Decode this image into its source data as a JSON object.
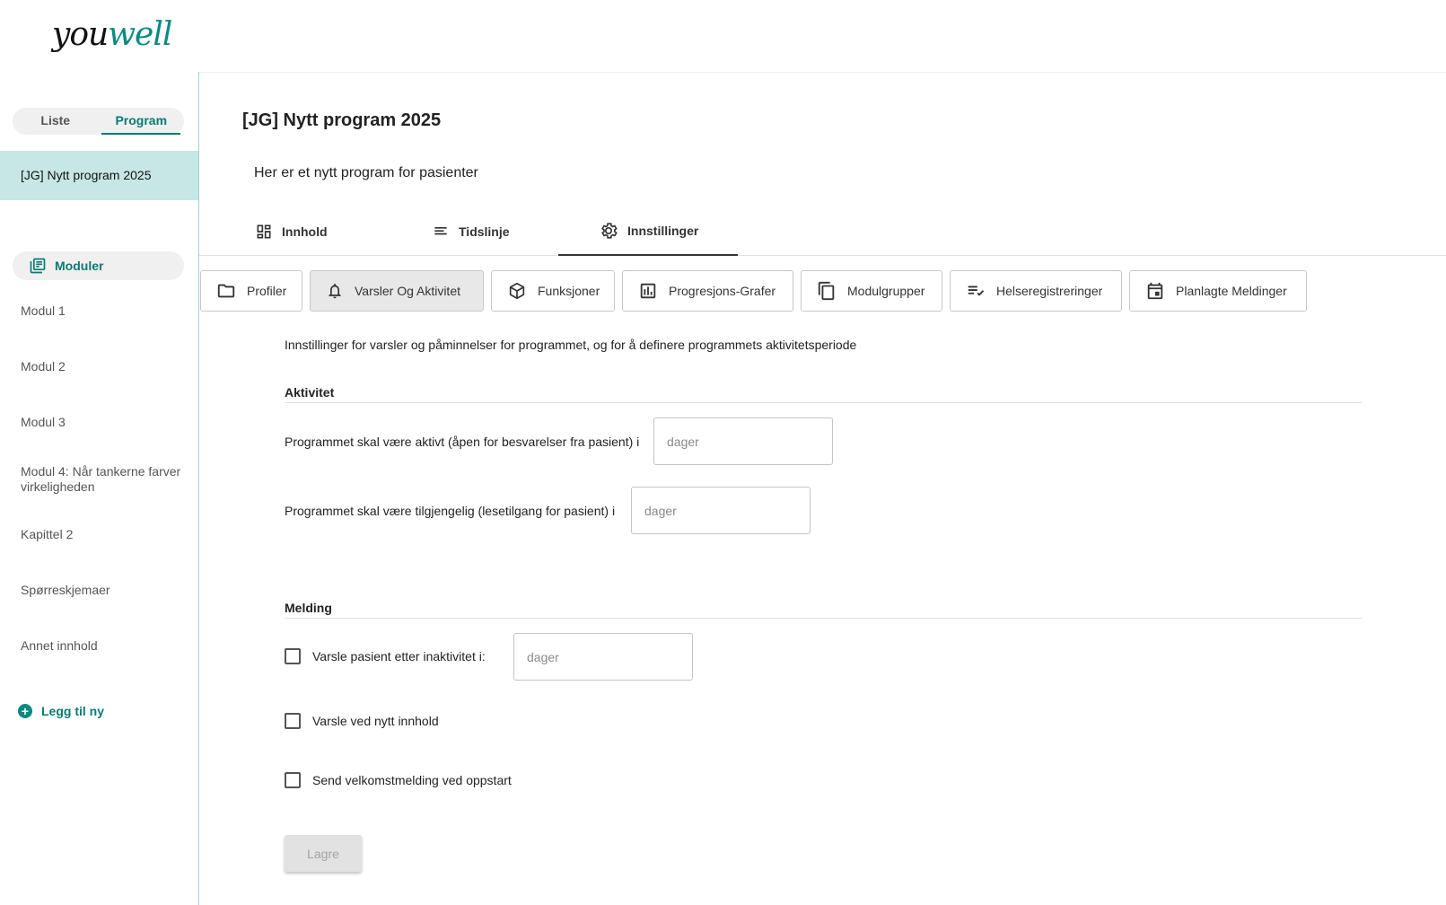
{
  "brand": {
    "logo_part1": "you",
    "logo_part2": "well"
  },
  "sidebar": {
    "toggle": {
      "list_label": "Liste",
      "program_label": "Program",
      "active": "Program"
    },
    "selected_program": "[JG] Nytt program 2025",
    "modules_label": "Moduler",
    "items": [
      {
        "label": "Modul 1"
      },
      {
        "label": "Modul 2"
      },
      {
        "label": "Modul 3"
      },
      {
        "label": "Modul 4: Når tankerne farver virkeligheden"
      },
      {
        "label": "Kapittel 2"
      },
      {
        "label": "Spørreskjemaer"
      },
      {
        "label": "Annet innhold"
      }
    ],
    "add_new_label": "Legg til ny"
  },
  "main": {
    "title": "[JG] Nytt program 2025",
    "description": "Her er et nytt program for pasienter",
    "tabs": [
      {
        "label": "Innhold",
        "icon": "dashboard-icon"
      },
      {
        "label": "Tidslinje",
        "icon": "lines-icon"
      },
      {
        "label": "Innstillinger",
        "icon": "gear-icon",
        "active": true
      }
    ],
    "subtabs": [
      {
        "label": "Profiler",
        "icon": "folder-icon"
      },
      {
        "label": "Varsler Og Aktivitet",
        "icon": "bell-icon",
        "active": true
      },
      {
        "label": "Funksjoner",
        "icon": "cube-icon"
      },
      {
        "label": "Progresjons-Grafer",
        "icon": "bar-chart-icon"
      },
      {
        "label": "Modulgrupper",
        "icon": "copy-icon"
      },
      {
        "label": "Helseregistreringer",
        "icon": "edit-note-icon"
      },
      {
        "label": "Planlagte Meldinger",
        "icon": "calendar-icon"
      }
    ],
    "settings": {
      "intro": "Innstillinger for varsler og påminnelser for programmet, og for å definere programmets aktivitetsperiode",
      "activity": {
        "heading": "Aktivitet",
        "active_label": "Programmet skal være aktivt (åpen for besvarelser fra pasient) i",
        "active_placeholder": "dager",
        "available_label": "Programmet skal være tilgjengelig (lesetilgang for pasient) i",
        "available_placeholder": "dager"
      },
      "message": {
        "heading": "Melding",
        "inactivity_label": "Varsle pasient etter inaktivitet i:",
        "inactivity_placeholder": "dager",
        "new_content_label": "Varsle ved nytt innhold",
        "welcome_label": "Send velkomstmelding ved oppstart"
      },
      "save_label": "Lagre"
    }
  },
  "colors": {
    "accent": "#0a7a74",
    "selected_bg": "#c6e7e5",
    "sidebar_border": "#9fd3d0"
  }
}
